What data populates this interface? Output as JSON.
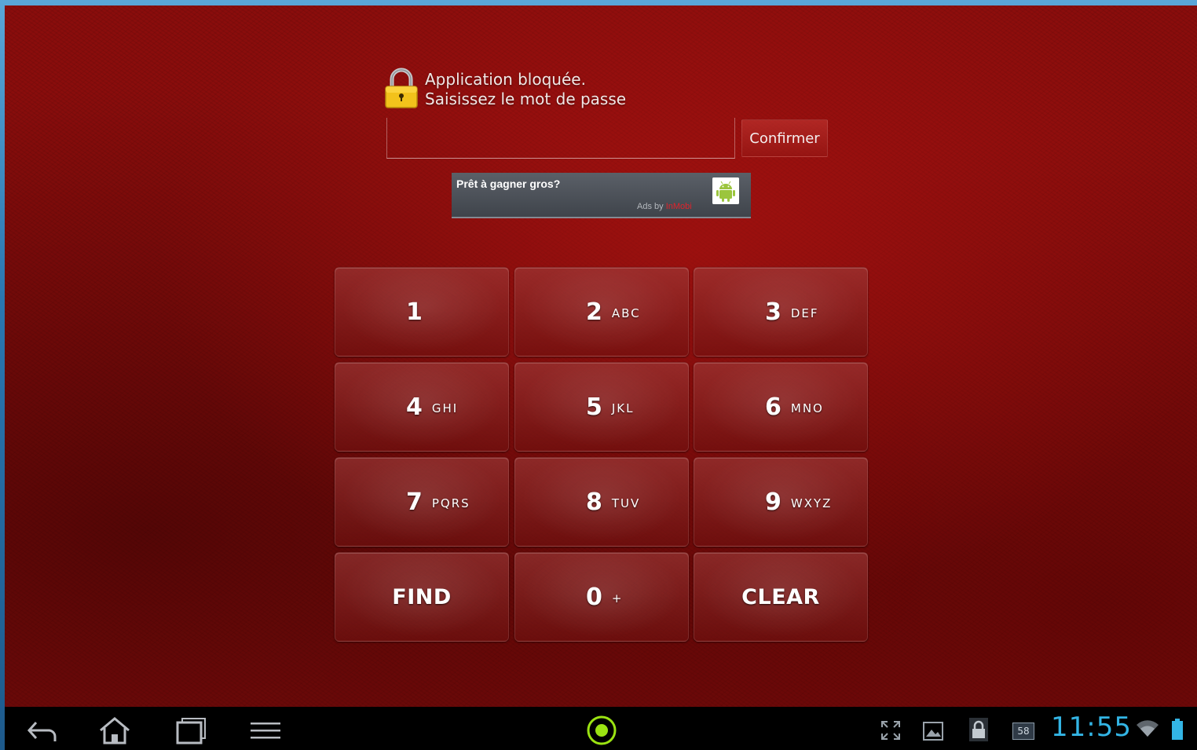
{
  "lock_screen": {
    "title_line1": "Application bloquée.",
    "title_line2": "Saisissez le mot de passe",
    "password_value": "",
    "confirm_label": "Confirmer"
  },
  "ad": {
    "headline": "Prêt à gagner gros?",
    "byline_prefix": "Ads by ",
    "byline_brand": "InMobi"
  },
  "keypad": {
    "keys": [
      {
        "digit": "1",
        "letters": ""
      },
      {
        "digit": "2",
        "letters": "ABC"
      },
      {
        "digit": "3",
        "letters": "DEF"
      },
      {
        "digit": "4",
        "letters": "GHI"
      },
      {
        "digit": "5",
        "letters": "JKL"
      },
      {
        "digit": "6",
        "letters": "MNO"
      },
      {
        "digit": "7",
        "letters": "PQRS"
      },
      {
        "digit": "8",
        "letters": "TUV"
      },
      {
        "digit": "9",
        "letters": "WXYZ"
      },
      {
        "digit": "0",
        "letters": "+"
      }
    ],
    "find_label": "FIND",
    "clear_label": "CLEAR"
  },
  "systembar": {
    "clock": "11:55",
    "notification_count": "58",
    "icons": [
      "back-icon",
      "home-icon",
      "recent-apps-icon",
      "menu-icon",
      "app-launcher-icon",
      "fullscreen-icon",
      "image-icon",
      "lock-icon",
      "notification-count-icon",
      "wifi-icon",
      "battery-icon"
    ]
  },
  "colors": {
    "background": "#8a0d0c",
    "clock": "#33b5e5",
    "ad_brand": "#e0232b",
    "launcher_ring": "#9be312"
  }
}
